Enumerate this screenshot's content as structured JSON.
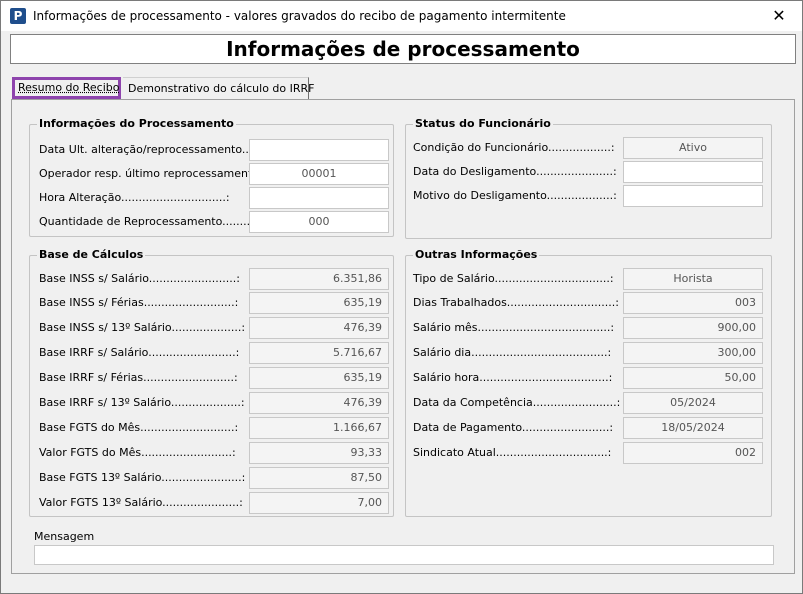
{
  "window": {
    "title": "Informações de processamento - valores gravados do recibo de pagamento intermitente",
    "app_icon_letter": "P",
    "close_glyph": "✕"
  },
  "header": {
    "title": "Informações de processamento"
  },
  "tabs": [
    {
      "label": "Resumo do Recibo",
      "active": true
    },
    {
      "label": "Demonstrativo do cálculo do IRRF",
      "active": false
    }
  ],
  "processamento": {
    "title": "Informações do Processamento",
    "fields": [
      {
        "label": "Data Ult. alteração/reprocessamento....:",
        "value": ""
      },
      {
        "label": "Operador resp. último reprocessamento.:",
        "value": "00001"
      },
      {
        "label": "Hora Alteração..............................:",
        "value": ""
      },
      {
        "label": "Quantidade de Reprocessamento.........:",
        "value": "000"
      }
    ]
  },
  "funcionario": {
    "title": "Status do Funcionário",
    "fields": [
      {
        "label": "Condição do Funcionário..................:",
        "value": "Ativo"
      },
      {
        "label": "Data do Desligamento......................:",
        "value": ""
      },
      {
        "label": "Motivo do Desligamento...................:",
        "value": ""
      }
    ]
  },
  "base_calculos": {
    "title": "Base de Cálculos",
    "fields": [
      {
        "label": "Base INSS s/ Salário.........................:",
        "value": "6.351,86"
      },
      {
        "label": "Base INSS s/ Férias..........................:",
        "value": "635,19"
      },
      {
        "label": "Base INSS s/ 13º Salário....................:",
        "value": "476,39"
      },
      {
        "label": "Base IRRF s/ Salário.........................:",
        "value": "5.716,67"
      },
      {
        "label": "Base IRRF s/ Férias..........................:",
        "value": "635,19"
      },
      {
        "label": "Base IRRF s/ 13º Salário....................:",
        "value": "476,39"
      },
      {
        "label": "Base FGTS do Mês...........................:",
        "value": "1.166,67"
      },
      {
        "label": "Valor FGTS do Mês..........................:",
        "value": "93,33"
      },
      {
        "label": "Base FGTS 13º Salário.......................:",
        "value": "87,50"
      },
      {
        "label": "Valor FGTS 13º Salário......................:",
        "value": "7,00"
      }
    ]
  },
  "outras": {
    "title": "Outras Informações",
    "fields": [
      {
        "label": "Tipo de Salário.................................:",
        "value": "Horista",
        "align": "c"
      },
      {
        "label": "Dias Trabalhados...............................:",
        "value": "003",
        "align": "r"
      },
      {
        "label": "Salário mês......................................:",
        "value": "900,00",
        "align": "r"
      },
      {
        "label": "Salário dia.......................................:",
        "value": "300,00",
        "align": "r"
      },
      {
        "label": "Salário hora.....................................:",
        "value": "50,00",
        "align": "r"
      },
      {
        "label": "Data da Competência........................:",
        "value": "05/2024",
        "align": "c"
      },
      {
        "label": "Data de Pagamento.........................:",
        "value": "18/05/2024",
        "align": "c"
      },
      {
        "label": "Sindicato Atual................................:",
        "value": "002",
        "align": "r"
      }
    ]
  },
  "mensagem": {
    "label": "Mensagem",
    "value": ""
  }
}
